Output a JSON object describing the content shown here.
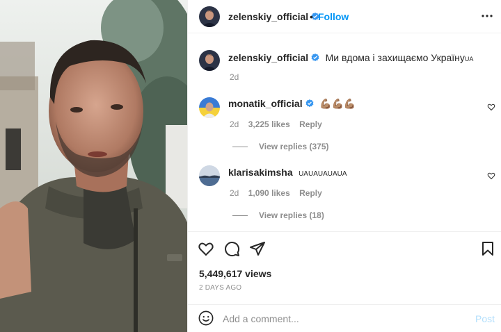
{
  "post": {
    "author": "zelenskiy_official",
    "dot": "•",
    "follow_label": "Follow",
    "caption": "Ми вдома і захищаємо Україну",
    "caption_flag": "UA",
    "caption_age": "2d"
  },
  "comments": [
    {
      "username": "monatik_official",
      "text": "💪🏽💪🏽💪🏽",
      "age": "2d",
      "likes": "3,225 likes",
      "reply": "Reply",
      "view_replies": "View replies (375)"
    },
    {
      "username": "klarisakimsha",
      "text": "UAUAUAUAUA",
      "age": "2d",
      "likes": "1,090 likes",
      "reply": "Reply",
      "view_replies": "View replies (18)"
    }
  ],
  "stats": {
    "views": "5,449,617 views",
    "posted": "2 DAYS AGO"
  },
  "composer": {
    "placeholder": "Add a comment...",
    "post_label": "Post"
  },
  "colors": {
    "accent": "#0095f6",
    "verified": "#3897f0",
    "secondary_text": "#8e8e8e"
  }
}
